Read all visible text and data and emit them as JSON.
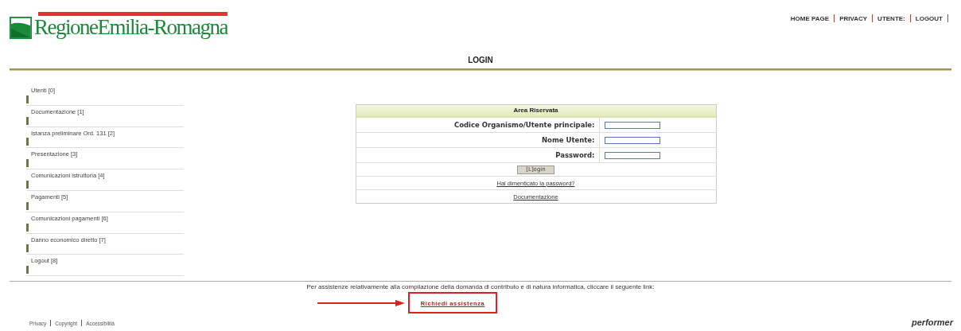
{
  "header": {
    "logo_text": "RegioneEmilia-Romagna",
    "nav": [
      "HOME PAGE",
      "PRIVACY",
      "UTENTE:",
      "LOGOUT"
    ]
  },
  "page_title": "LOGIN",
  "sidebar": {
    "items": [
      {
        "label": "Utenti [0]"
      },
      {
        "label": "Documentazione [1]"
      },
      {
        "label": "Istanza preliminare Ord. 131 [2]"
      },
      {
        "label": "Presentazione [3]"
      },
      {
        "label": "Comunicazioni istruttoria [4]"
      },
      {
        "label": "Pagamenti [5]"
      },
      {
        "label": "Comunicazioni pagamenti [6]"
      },
      {
        "label": "Danno economico diretto [7]"
      },
      {
        "label": "Logout [8]"
      }
    ]
  },
  "login": {
    "title": "Area Riservata",
    "fields": [
      {
        "label": "Codice Organismo/Utente principale:"
      },
      {
        "label": "Nome Utente:"
      },
      {
        "label": "Password:"
      }
    ],
    "button": "[L]ogin",
    "links": [
      "Hai dimenticato la password?",
      "Documentazione"
    ]
  },
  "assistance": {
    "text": "Per assistenze relativamente alla compilazione della domanda di contributo e di natura informatica, cliccare il seguente link:",
    "link": "Richiedi assistenza"
  },
  "footer": {
    "links": [
      "Privacy",
      "Copyright",
      "Accessibilità"
    ],
    "brand": "performer"
  }
}
